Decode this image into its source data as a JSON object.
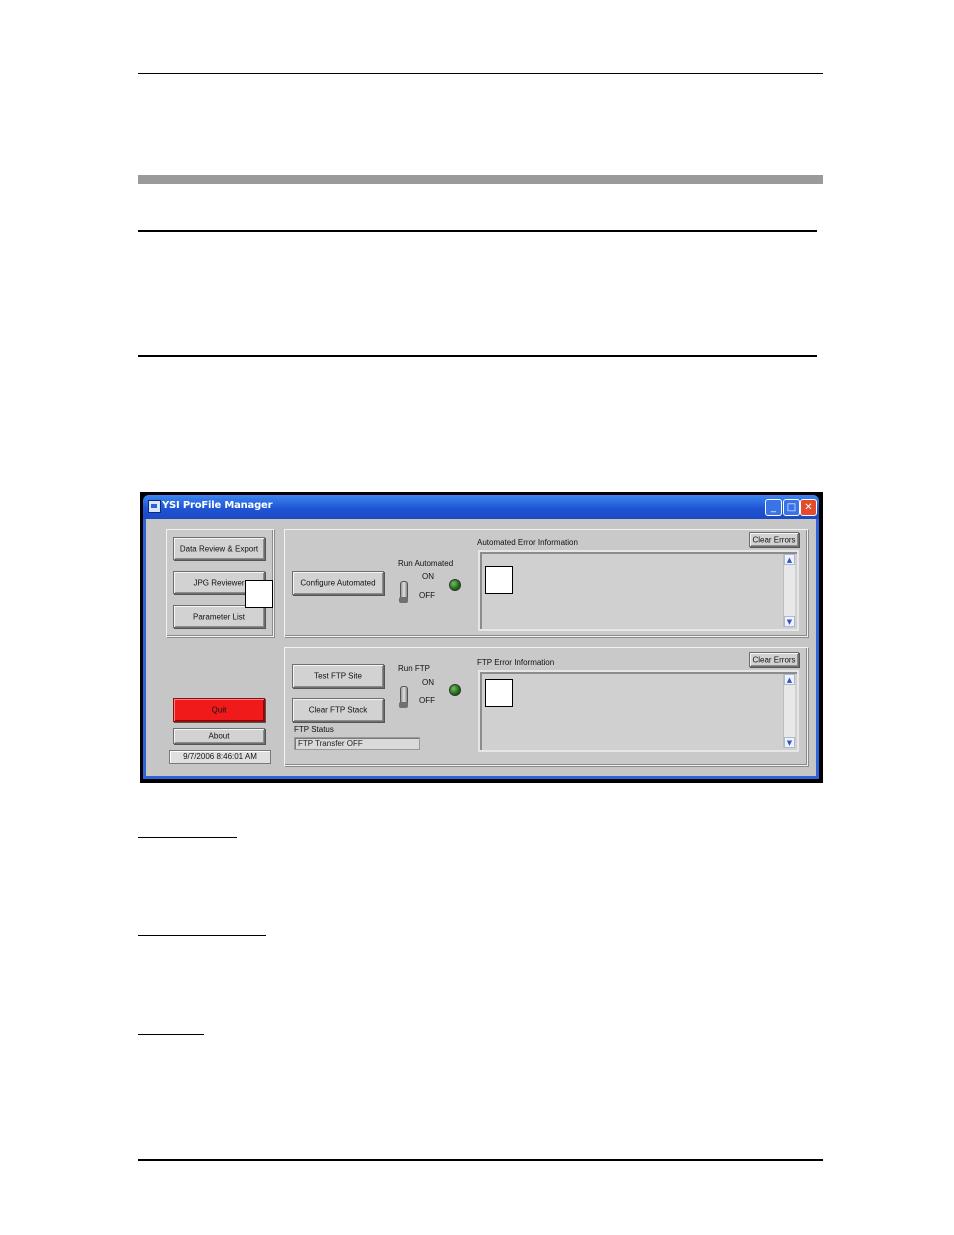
{
  "window": {
    "title": "YSI ProFile Manager",
    "minimize_glyph": "_",
    "maximize_glyph": "□",
    "close_glyph": "✕"
  },
  "left_panel": {
    "data_review_label": "Data Review & Export",
    "jpg_reviewer_label": "JPG Reviewer",
    "parameter_list_label": "Parameter List",
    "quit_label": "Quit",
    "about_label": "About",
    "datetime": "9/7/2006 8:46:01 AM"
  },
  "automated": {
    "configure_label": "Configure Automated",
    "run_label": "Run Automated",
    "on_label": "ON",
    "off_label": "OFF",
    "error_title": "Automated Error Information",
    "clear_errors_label": "Clear Errors"
  },
  "ftp": {
    "test_label": "Test FTP Site",
    "clear_stack_label": "Clear FTP Stack",
    "run_label": "Run FTP",
    "on_label": "ON",
    "off_label": "OFF",
    "status_title": "FTP Status",
    "status_value": "FTP Transfer OFF",
    "error_title": "FTP Error Information",
    "clear_errors_label": "Clear Errors"
  },
  "scroll": {
    "up_glyph": "▲",
    "down_glyph": "▼"
  },
  "colors": {
    "titlebar": "#1f55d5",
    "quit_button": "#f01a1a",
    "led_off": "#1f6b17"
  }
}
